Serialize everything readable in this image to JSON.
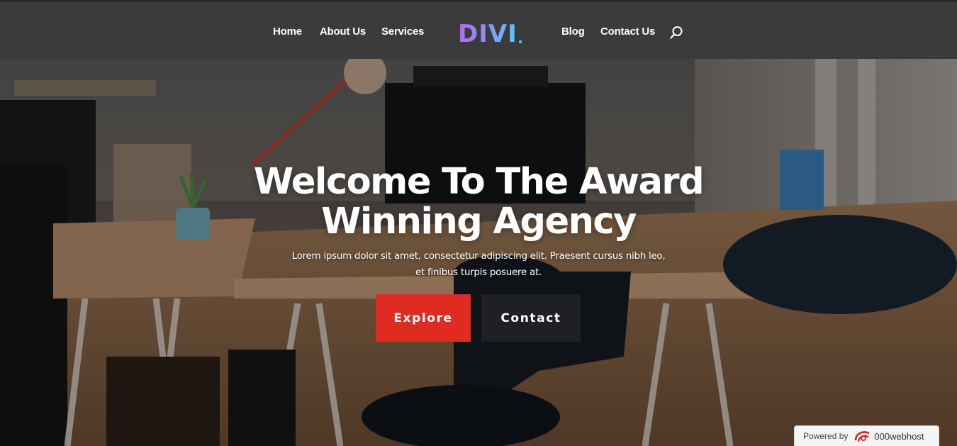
{
  "header": {
    "nav_left": [
      "Home",
      "About Us",
      "Services"
    ],
    "nav_right": [
      "Blog",
      "Contact Us"
    ],
    "logo": "DIVI",
    "search_icon": "search-icon"
  },
  "hero": {
    "title_line1": "Welcome To The Award",
    "title_line2": "Winning Agency",
    "subtitle_line1": "Lorem ipsum dolor sit amet, consectetur adipiscing elit. Praesent cursus nibh leo,",
    "subtitle_line2": "et finibus turpis posuere at.",
    "explore_label": "Explore",
    "contact_label": "Contact"
  },
  "badge": {
    "powered_by": "Powered by",
    "host": "000webhost"
  },
  "colors": {
    "header_bg": "#3b3b3b",
    "explore_bg": "#e02b20",
    "contact_bg": "#1e2026",
    "logo_gradient_start": "#b36bf2",
    "logo_gradient_end": "#5cc8f8"
  }
}
